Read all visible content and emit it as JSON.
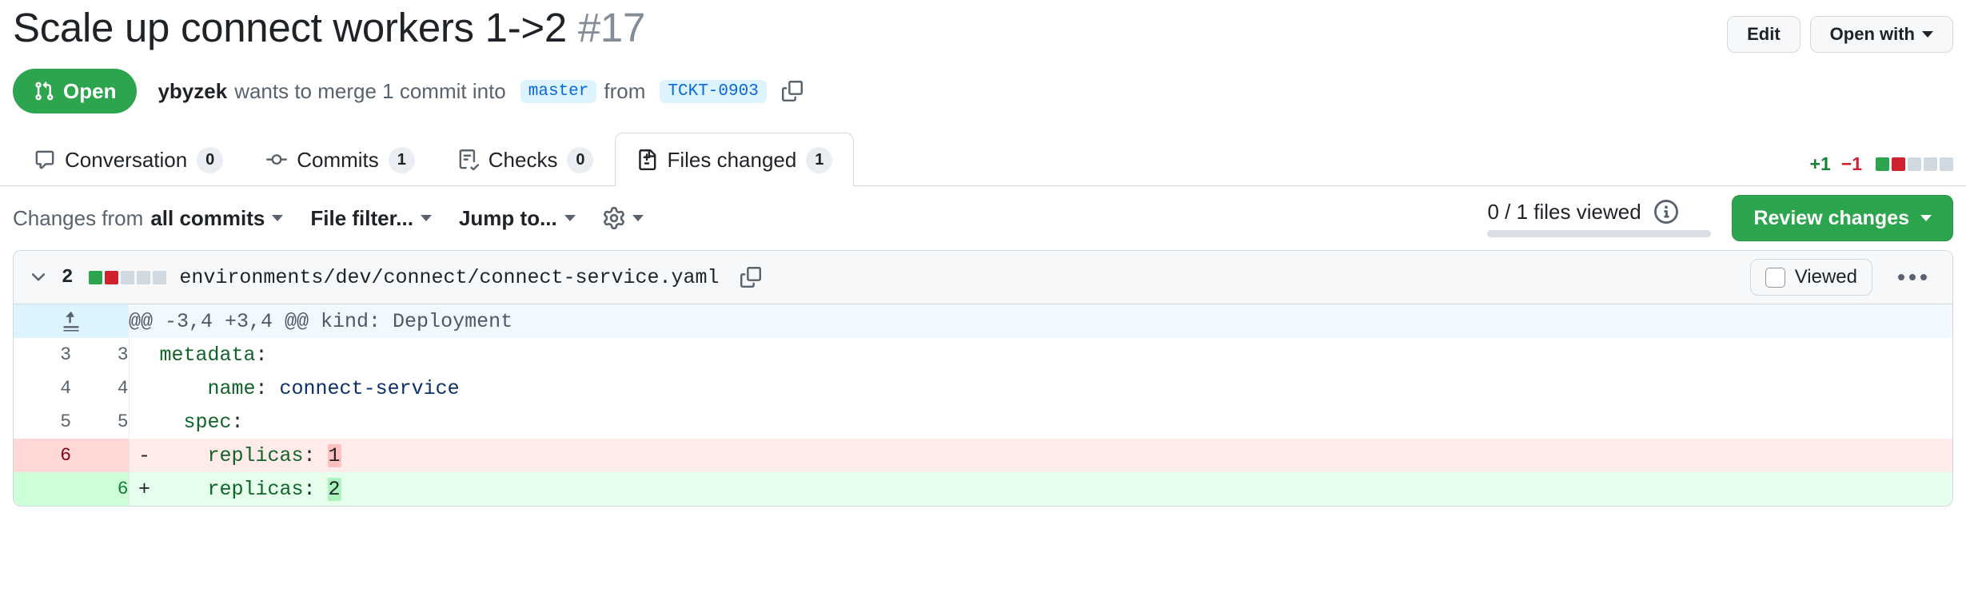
{
  "header": {
    "title": "Scale up connect workers 1->2",
    "number": "#17",
    "edit_label": "Edit",
    "open_with_label": "Open with"
  },
  "merge_info": {
    "state": "Open",
    "author": "ybyzek",
    "text_before": "wants to merge 1 commit into",
    "base_branch": "master",
    "text_middle": "from",
    "head_branch": "TCKT-0903"
  },
  "tabs": [
    {
      "label": "Conversation",
      "count": "0",
      "icon": "comment-icon",
      "active": false
    },
    {
      "label": "Commits",
      "count": "1",
      "icon": "commit-icon",
      "active": false
    },
    {
      "label": "Checks",
      "count": "0",
      "icon": "checklist-icon",
      "active": false
    },
    {
      "label": "Files changed",
      "count": "1",
      "icon": "file-diff-icon",
      "active": true
    }
  ],
  "diffstat": {
    "additions": "+1",
    "deletions": "−1",
    "blocks": [
      "g",
      "r",
      "n",
      "n",
      "n"
    ]
  },
  "toolbar": {
    "changes_from_label": "Changes from",
    "changes_from_value": "all commits",
    "file_filter_label": "File filter...",
    "jump_to_label": "Jump to...",
    "gear_label": "gear-icon",
    "files_viewed": "0 / 1 files viewed",
    "review_changes_label": "Review changes"
  },
  "file": {
    "change_count": "2",
    "blocks": [
      "g",
      "r",
      "n",
      "n",
      "n"
    ],
    "path": "environments/dev/connect/connect-service.yaml",
    "viewed_label": "Viewed"
  },
  "diff": {
    "hunk_header": "@@ -3,4 +3,4 @@ kind: Deployment",
    "rows": [
      {
        "type": "hunk",
        "old": "",
        "new": "",
        "mark": "",
        "text": "@@ -3,4 +3,4 @@ kind: Deployment"
      },
      {
        "type": "ctx",
        "old": "3",
        "new": "3",
        "mark": "",
        "key": "metadata",
        "sep": ":",
        "value": "",
        "text": "  metadata:"
      },
      {
        "type": "ctx",
        "old": "4",
        "new": "4",
        "mark": "",
        "key": "    name",
        "sep": ": ",
        "value": "connect-service",
        "text": "    name: connect-service"
      },
      {
        "type": "ctx",
        "old": "5",
        "new": "5",
        "mark": "",
        "key": "  spec",
        "sep": ":",
        "value": "",
        "text": "  spec:"
      },
      {
        "type": "del",
        "old": "6",
        "new": "",
        "mark": "-",
        "key": "    replicas",
        "sep": ": ",
        "value": "1",
        "text": "    replicas: 1"
      },
      {
        "type": "add",
        "old": "",
        "new": "6",
        "mark": "+",
        "key": "    replicas",
        "sep": ": ",
        "value": "2",
        "text": "    replicas: 2"
      }
    ]
  },
  "colors": {
    "open_green": "#2da44e",
    "addition_green": "#1a7f37",
    "deletion_red": "#cf222e",
    "link_blue": "#0969da"
  }
}
